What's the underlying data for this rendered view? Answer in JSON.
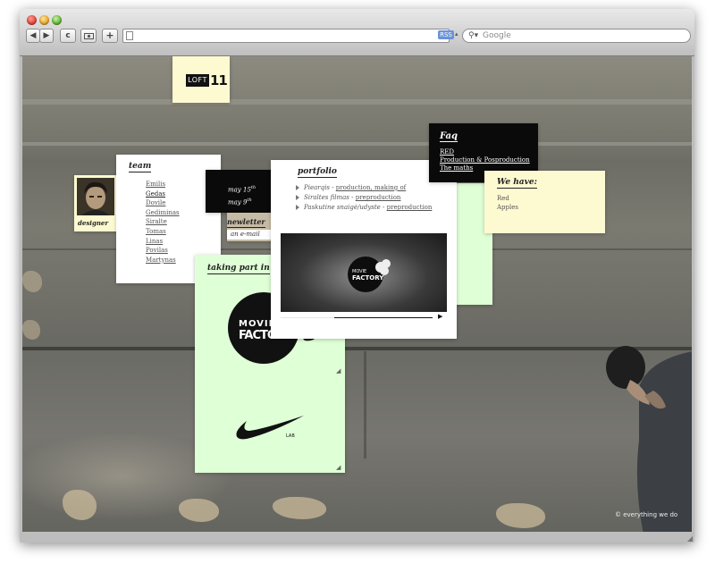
{
  "browser": {
    "nav_back": "◀",
    "nav_forward": "▶",
    "reload_icon": "c",
    "add_icon": "+",
    "rss_label": "RSS",
    "search_placeholder": "Google"
  },
  "site": {
    "logo_text": "LOFT",
    "logo_number": "11",
    "team": {
      "heading": "team",
      "members": [
        "Emilis",
        "Gedas",
        "Dovile",
        "Gediminas",
        "Siralte",
        "Tomas",
        "Linas",
        "Povilas",
        "Martynas"
      ],
      "active_index": 1
    },
    "designer_label": "designer",
    "dates": {
      "line1": "may 15",
      "line1_sup": "th",
      "line2": "may 9",
      "line2_sup": "th"
    },
    "newsletter": {
      "heading": "newletter",
      "input_placeholder": "an e-mail"
    },
    "portfolio": {
      "heading": "portfolio",
      "items": [
        {
          "name": "Piearqis",
          "sep": " - ",
          "link": "production, making of"
        },
        {
          "name": "Siraltes filmas",
          "sep": " - ",
          "link": "preproduction"
        },
        {
          "name": "Paskutine snaigė/udyste",
          "sep": " - ",
          "link": "preproduction"
        }
      ],
      "video_logo_line1": "MOVIE",
      "video_logo_line2": "FACTORY"
    },
    "faq": {
      "heading": "Faq",
      "links": [
        "RED",
        "Production & Posproduction",
        "The maths"
      ]
    },
    "we_have": {
      "heading": "We have:",
      "items": [
        "Red",
        "Apples"
      ]
    },
    "taking_part": {
      "heading": "taking part in",
      "logo1_line1": "MOVIE",
      "logo1_line2": "FACTORY",
      "logo2_caption": "LAB"
    },
    "footer": "© everything we do"
  }
}
